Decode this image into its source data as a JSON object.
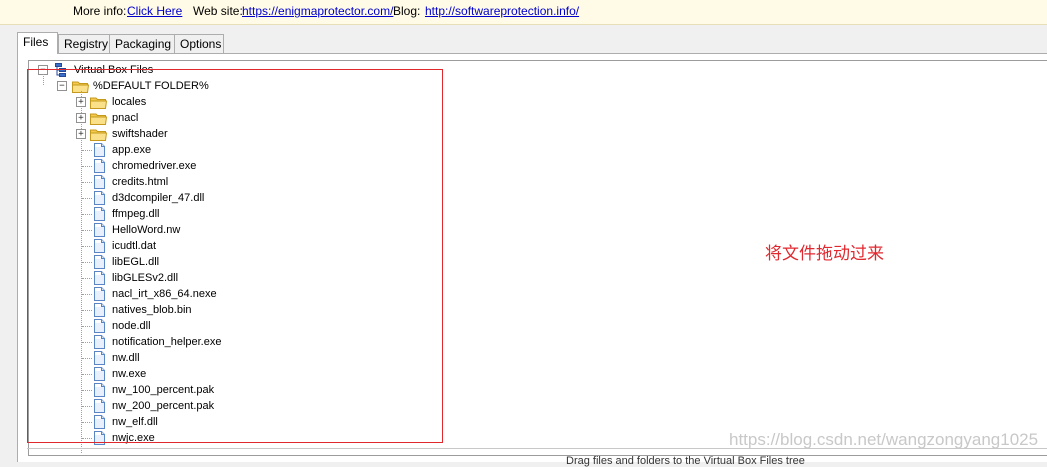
{
  "infobar": {
    "more_info_label": "More info:",
    "more_info_link": "Click Here",
    "website_label": "Web site:",
    "website_link": "https://enigmaprotector.com/",
    "blog_label": "Blog:",
    "blog_link": "http://softwareprotection.info/"
  },
  "tabs": [
    "Files",
    "Registry",
    "Packaging",
    "Options"
  ],
  "tree": {
    "root": "Virtual Box Files",
    "default_folder": "%DEFAULT FOLDER%",
    "folders": [
      "locales",
      "pnacl",
      "swiftshader"
    ],
    "files": [
      "app.exe",
      "chromedriver.exe",
      "credits.html",
      "d3dcompiler_47.dll",
      "ffmpeg.dll",
      "HelloWord.nw",
      "icudtl.dat",
      "libEGL.dll",
      "libGLESv2.dll",
      "nacl_irt_x86_64.nexe",
      "natives_blob.bin",
      "node.dll",
      "notification_helper.exe",
      "nw.dll",
      "nw.exe",
      "nw_100_percent.pak",
      "nw_200_percent.pak",
      "nw_elf.dll",
      "nwjc.exe"
    ]
  },
  "annotation": "将文件拖动过来",
  "watermark": "https://blog.csdn.net/wangzongyang1025",
  "footer": "Drag files and folders to the Virtual Box Files tree"
}
